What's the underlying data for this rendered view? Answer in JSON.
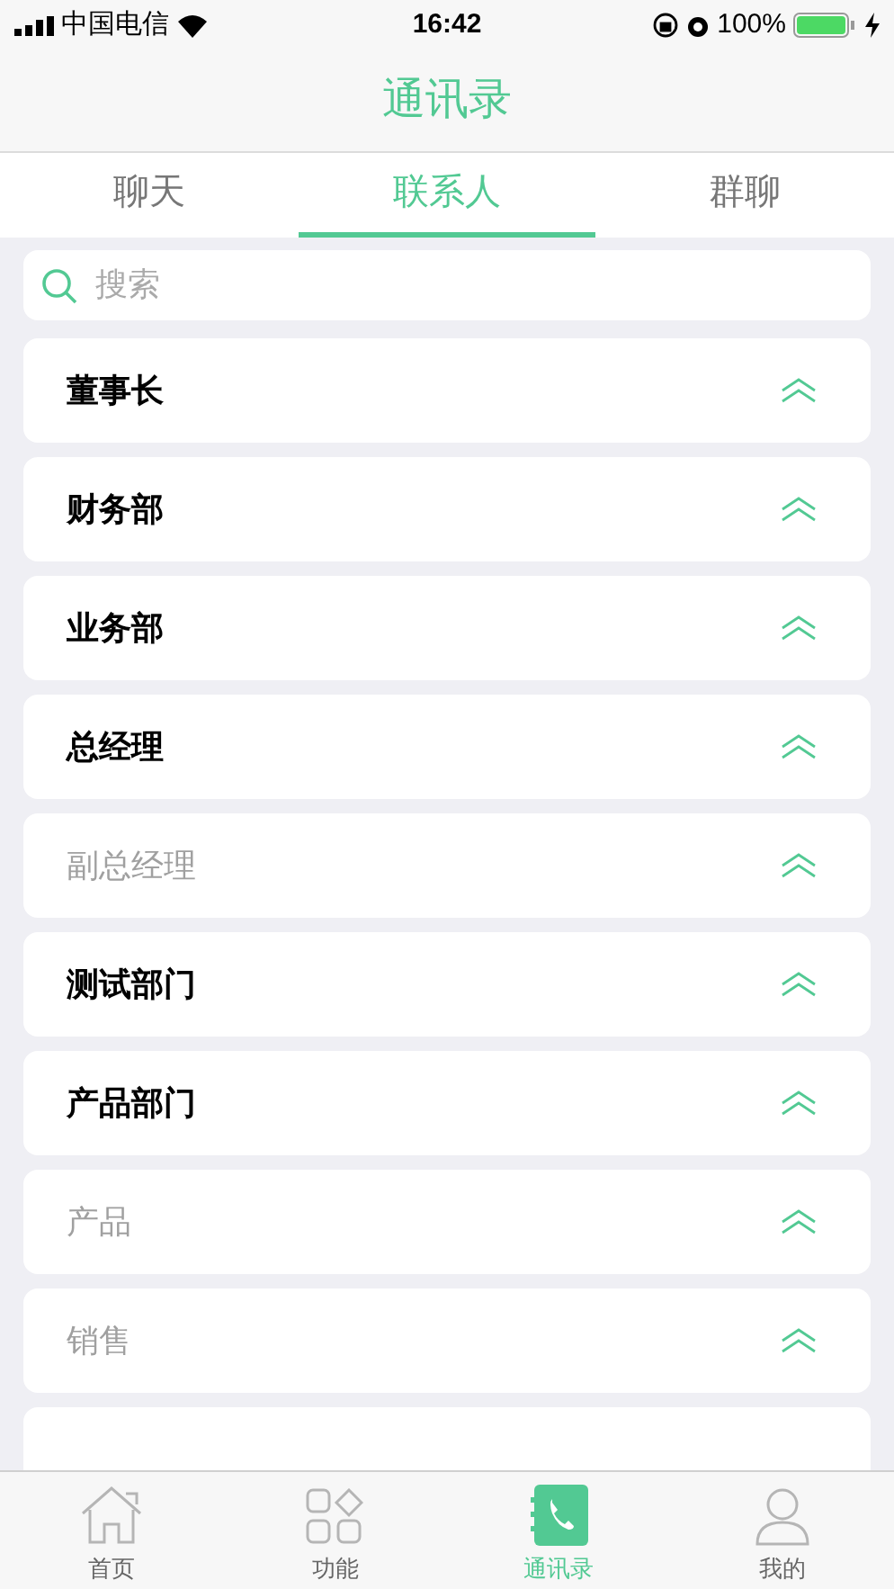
{
  "status_bar": {
    "carrier": "中国电信",
    "time": "16:42",
    "battery": "100%"
  },
  "header": {
    "title": "通讯录"
  },
  "tabs": [
    {
      "label": "聊天",
      "selected": false
    },
    {
      "label": "联系人",
      "selected": true
    },
    {
      "label": "群聊",
      "selected": false
    }
  ],
  "search": {
    "placeholder": "搜索"
  },
  "groups": [
    {
      "name": "董事长",
      "disabled": false
    },
    {
      "name": "财务部",
      "disabled": false
    },
    {
      "name": "业务部",
      "disabled": false
    },
    {
      "name": "总经理",
      "disabled": false
    },
    {
      "name": "副总经理",
      "disabled": true
    },
    {
      "name": "测试部门",
      "disabled": false
    },
    {
      "name": "产品部门",
      "disabled": false
    },
    {
      "name": "产品",
      "disabled": true
    },
    {
      "name": "销售",
      "disabled": true
    }
  ],
  "bottom_nav": [
    {
      "label": "首页",
      "selected": false
    },
    {
      "label": "功能",
      "selected": false
    },
    {
      "label": "通讯录",
      "selected": true
    },
    {
      "label": "我的",
      "selected": false
    }
  ]
}
